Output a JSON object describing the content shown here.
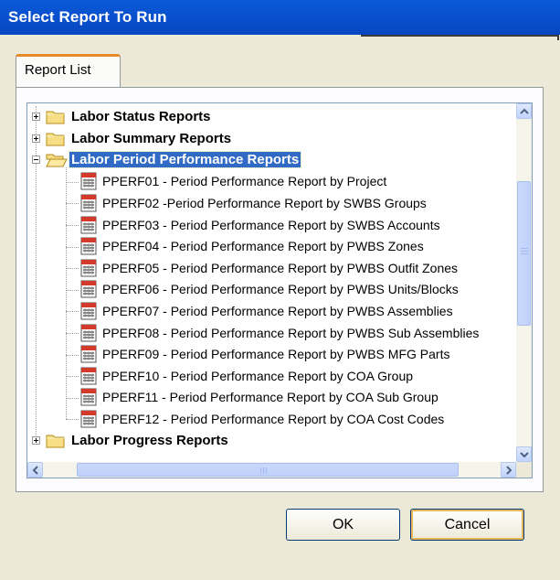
{
  "window": {
    "title": "Select Report To Run"
  },
  "tabs": [
    {
      "label": "Report List"
    }
  ],
  "tree": {
    "folders_top": [
      {
        "label": "Labor  Status Reports",
        "expanded": false
      },
      {
        "label": "Labor  Summary Reports",
        "expanded": false
      }
    ],
    "selected_folder": {
      "label": "Labor Period Performance Reports",
      "expanded": true
    },
    "reports": [
      "PPERF01 - Period Performance Report by Project",
      "PPERF02 -Period Performance Report by SWBS Groups",
      "PPERF03 - Period Performance Report by SWBS Accounts",
      "PPERF04 - Period Performance Report by PWBS Zones",
      "PPERF05 - Period Performance Report by PWBS Outfit Zones",
      "PPERF06 - Period Performance Report by PWBS Units/Blocks",
      "PPERF07 - Period Performance Report by PWBS Assemblies",
      "PPERF08 - Period Performance Report by PWBS Sub Assemblies",
      "PPERF09 - Period Performance Report by PWBS MFG Parts",
      "PPERF10 - Period Performance Report by COA Group",
      "PPERF11 - Period Performance Report by COA Sub Group",
      "PPERF12 - Period Performance Report by COA Cost Codes"
    ],
    "folders_bottom": [
      {
        "label": "Labor Progress Reports",
        "expanded": false
      }
    ]
  },
  "buttons": {
    "ok": "OK",
    "cancel": "Cancel"
  },
  "icons": {
    "folder": "folder-icon",
    "report": "report-icon"
  }
}
